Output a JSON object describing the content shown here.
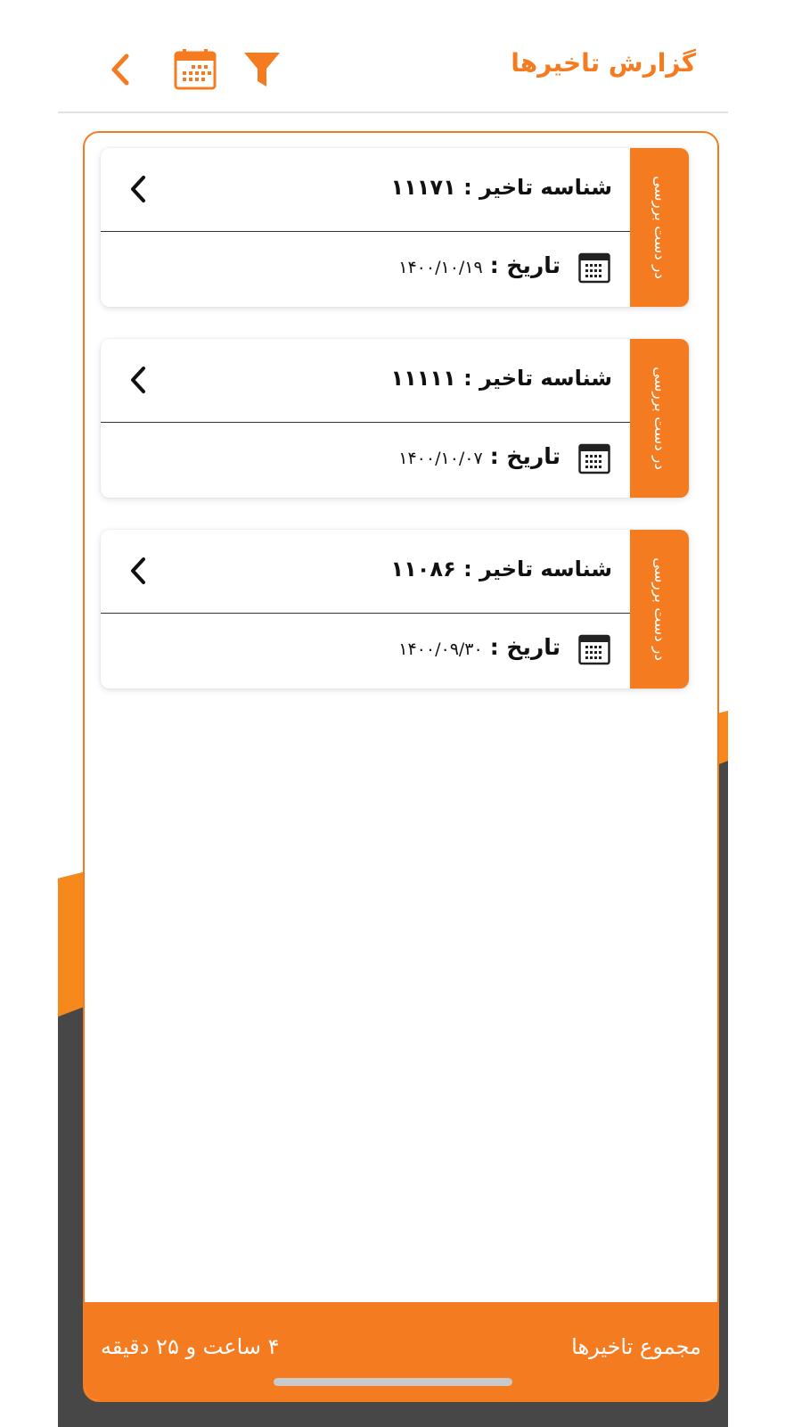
{
  "header": {
    "title": "گزارش تاخیرها",
    "icons": [
      "chevron-left-icon",
      "calendar-icon",
      "filter-icon"
    ]
  },
  "colors": {
    "accent": "#f47b20",
    "dark_bg": "#474747"
  },
  "items": [
    {
      "status": "در دست بررسی",
      "id_text": "شناسه تاخیر : ۱۱۱۷۱",
      "date_label": "تاریخ :",
      "date_value": "۱۴۰۰/۱۰/۱۹"
    },
    {
      "status": "در دست بررسی",
      "id_text": "شناسه تاخیر : ۱۱۱۱۱",
      "date_label": "تاریخ :",
      "date_value": "۱۴۰۰/۱۰/۰۷"
    },
    {
      "status": "در دست بررسی",
      "id_text": "شناسه تاخیر : ۱۱۰۸۶",
      "date_label": "تاریخ :",
      "date_value": "۱۴۰۰/۰۹/۳۰"
    }
  ],
  "footer": {
    "label": "مجموع تاخیرها",
    "value": "۴ ساعت و ۲۵ دقیقه"
  }
}
